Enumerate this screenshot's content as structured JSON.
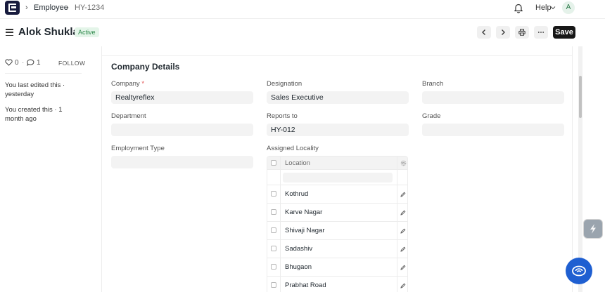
{
  "navbar": {
    "breadcrumbs": [
      "Employee",
      "HY-1234"
    ],
    "help_label": "Help",
    "avatar_initial": "A"
  },
  "header": {
    "title": "Alok Shukla",
    "status": "Active",
    "save_label": "Save"
  },
  "sidebar": {
    "likes": "0",
    "comments": "1",
    "follow_label": "FOLLOW",
    "last_edited": "You last edited this · yesterday",
    "created": "You created this · 1 month ago"
  },
  "section": {
    "title": "Company Details"
  },
  "fields": {
    "company": {
      "label": "Company",
      "required_mark": "*",
      "value": "Realtyreflex"
    },
    "designation": {
      "label": "Designation",
      "value": "Sales Executive"
    },
    "branch": {
      "label": "Branch",
      "value": ""
    },
    "department": {
      "label": "Department",
      "value": ""
    },
    "reports_to": {
      "label": "Reports to",
      "value": "HY-012"
    },
    "grade": {
      "label": "Grade",
      "value": ""
    },
    "employment_type": {
      "label": "Employment Type",
      "value": ""
    }
  },
  "assigned_locality": {
    "label": "Assigned Locality",
    "column_header": "Location",
    "rows": [
      "Kothrud",
      "Karve Nagar",
      "Shivaji Nagar",
      "Sadashiv",
      "Bhugaon",
      "Prabhat Road"
    ]
  },
  "colors": {
    "accent": "#171717",
    "active_badge": "#2f8a4c",
    "logo": "#171b3d",
    "chat_button": "#1f5fd1"
  }
}
